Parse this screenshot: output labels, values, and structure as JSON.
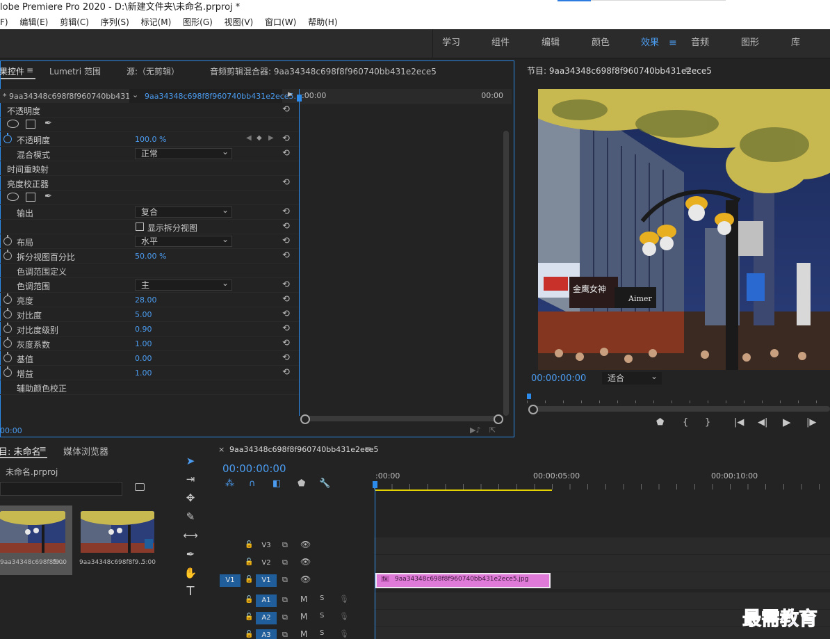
{
  "window": {
    "title": "lobe Premiere Pro 2020 - D:\\新建文件夹\\未命名.prproj *"
  },
  "menubar": [
    "F)",
    "编辑(E)",
    "剪辑(C)",
    "序列(S)",
    "标记(M)",
    "图形(G)",
    "视图(V)",
    "窗口(W)",
    "帮助(H)"
  ],
  "workspaces": {
    "tabs": [
      "学习",
      "组件",
      "编辑",
      "颜色",
      "效果",
      "音频",
      "图形",
      "库"
    ],
    "active": "效果",
    "menu_icon": "≡"
  },
  "effect_controls": {
    "tabs": [
      "果控件",
      "Lumetri 范围",
      "源:（无剪辑）",
      "音频剪辑混合器: 9aa34348c698f8f960740bb431e2ece5"
    ],
    "menu_icon": "≡",
    "source_label": "* 9aa34348c698f8f960740bb431e...",
    "clip_label": "9aa34348c698f8f960740bb431e2ece5...",
    "timeline_start": ":00:00",
    "timeline_end": "00:00",
    "current_time": "00:00",
    "rows": [
      {
        "label": "不透明度",
        "type": "section"
      },
      {
        "type": "shapes"
      },
      {
        "label": "不透明度",
        "type": "prop",
        "value": "100.0 %",
        "stopwatch": "on"
      },
      {
        "label": "混合模式",
        "type": "dropdown",
        "value": "正常"
      },
      {
        "label": "时间重映射",
        "type": "section"
      },
      {
        "label": "亮度校正器",
        "type": "section"
      },
      {
        "type": "shapes"
      },
      {
        "label": "输出",
        "type": "dropdown",
        "value": "复合"
      },
      {
        "label": "显示拆分视图",
        "type": "checkbox"
      },
      {
        "label": "布局",
        "type": "dropdown",
        "value": "水平",
        "stopwatch": "off"
      },
      {
        "label": "拆分视图百分比",
        "type": "prop",
        "value": "50.00 %",
        "stopwatch": "off"
      },
      {
        "label": "色调范围定义",
        "type": "label"
      },
      {
        "label": "色调范围",
        "type": "dropdown",
        "value": "主"
      },
      {
        "label": "亮度",
        "type": "prop",
        "value": "28.00",
        "stopwatch": "off"
      },
      {
        "label": "对比度",
        "type": "prop",
        "value": "5.00",
        "stopwatch": "off"
      },
      {
        "label": "对比度级别",
        "type": "prop",
        "value": "0.90",
        "stopwatch": "off"
      },
      {
        "label": "灰度系数",
        "type": "prop",
        "value": "1.00",
        "stopwatch": "off"
      },
      {
        "label": "基值",
        "type": "prop",
        "value": "0.00",
        "stopwatch": "off"
      },
      {
        "label": "增益",
        "type": "prop",
        "value": "1.00",
        "stopwatch": "off"
      },
      {
        "label": "辅助颜色校正",
        "type": "label"
      }
    ]
  },
  "program_monitor": {
    "title": "节目: 9aa34348c698f8f960740bb431e2ece5",
    "menu_icon": "≡",
    "timecode": "00:00:00:00",
    "zoom": "适合",
    "image_signs": [
      "金鹰女神",
      "Aimer"
    ]
  },
  "project": {
    "tabs": [
      "目: 未命名",
      "媒体浏览器"
    ],
    "menu_icon": "≡",
    "file_name": "未命名.prproj",
    "items": [
      {
        "name": "9aa34348c698f8f9...",
        "duration": "5:00"
      },
      {
        "name": "9aa34348c698f8f9...",
        "duration": "5:00"
      }
    ]
  },
  "timeline": {
    "close": "×",
    "sequence_name": "9aa34348c698f8f960740bb431e2ece5",
    "menu_icon": "≡",
    "timecode": "00:00:00:00",
    "ruler_labels": [
      ":00:00",
      "00:00:05:00",
      "00:00:10:00"
    ],
    "tracks": [
      {
        "name": "V3",
        "kind": "video",
        "selected": false
      },
      {
        "name": "V2",
        "kind": "video",
        "selected": false
      },
      {
        "name": "V1",
        "kind": "video",
        "selected": true,
        "source": "V1"
      },
      {
        "name": "A1",
        "kind": "audio",
        "selected": true
      },
      {
        "name": "A2",
        "kind": "audio",
        "selected": true
      },
      {
        "name": "A3",
        "kind": "audio",
        "selected": true
      }
    ],
    "clip": {
      "name": "9aa34348c698f8f960740bb431e2ece5.jpg",
      "fx": "fx"
    },
    "mute_label": "M",
    "solo_label": "S"
  },
  "watermark": "最需教育",
  "colors": {
    "accent": "#2d8ceb",
    "timecode": "#4b9cf0",
    "clip": "#e07ad8",
    "work_area": "#e4d300"
  }
}
